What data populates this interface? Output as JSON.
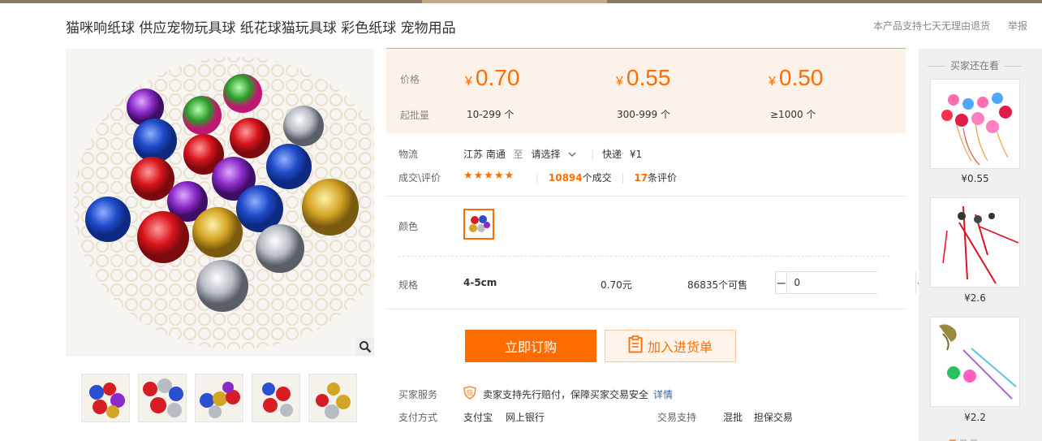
{
  "header": {
    "title": "猫咪响纸球 供应宠物玩具球 纸花球猫玩具球 彩色纸球 宠物用品",
    "guarantee": "本产品支持七天无理由退货",
    "report": "举报"
  },
  "pricing": {
    "price_label": "价格",
    "qty_label": "起批量",
    "currency": "¥",
    "tiers": [
      {
        "price": "0.70",
        "range": "10-299 个"
      },
      {
        "price": "0.55",
        "range": "300-999 个"
      },
      {
        "price": "0.50",
        "range": "≥1000 个"
      }
    ]
  },
  "logistics": {
    "label": "物流",
    "origin": "江苏 南通",
    "to": "至",
    "dest": "请选择",
    "express": "快递",
    "fee": "¥1"
  },
  "deals": {
    "label": "成交\\评价",
    "stars": "★★★★★",
    "sold_count": "10894",
    "sold_suffix": "个成交",
    "review_count": "17",
    "review_suffix": "条评价"
  },
  "color": {
    "label": "颜色"
  },
  "spec": {
    "label": "规格",
    "size": "4-5cm",
    "price": "0.70元",
    "stock": "86835个可售",
    "quantity": "0",
    "minus": "−",
    "plus": "+"
  },
  "actions": {
    "buy": "立即订购",
    "add_to_list": "加入进货单"
  },
  "service": {
    "label": "买家服务",
    "text": "卖家支持先行赔付，保障买家交易安全",
    "link": "详情"
  },
  "payment": {
    "label": "支付方式",
    "methods": [
      "支付宝",
      "网上银行"
    ]
  },
  "trade": {
    "label": "交易支持",
    "items": [
      "混批",
      "担保交易"
    ]
  },
  "sidebar": {
    "title": "买家还在看",
    "items": [
      {
        "price": "¥0.55"
      },
      {
        "price": "¥2.6"
      },
      {
        "price": "¥2.2"
      }
    ]
  },
  "colors": {
    "accent": "#ff6d00",
    "price_bg": "#fdf2e9",
    "link": "#3366aa"
  }
}
